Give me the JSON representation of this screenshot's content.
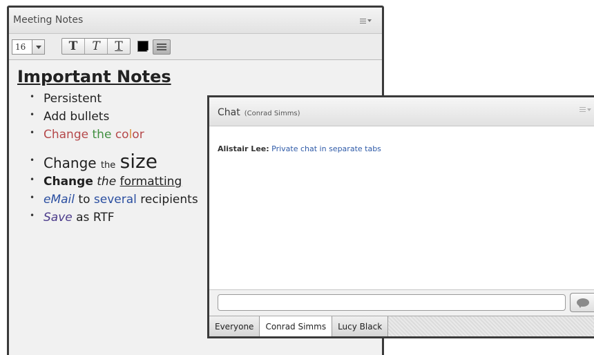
{
  "notes": {
    "title": "Meeting Notes",
    "toolbar": {
      "font_size": "16",
      "bold_glyph": "T",
      "italic_glyph": "T",
      "underline_glyph": "T",
      "text_color": "#000000"
    },
    "heading": "Important Notes",
    "items": {
      "persistent": "Persistent",
      "add_bullets": "Add bullets",
      "change_color": {
        "word1": "Change",
        "word2": "the",
        "word3_a": "co",
        "word3_b": "l",
        "word3_c": "or"
      },
      "change_size": {
        "word1": "Change",
        "word2": "the",
        "word3": "size"
      },
      "change_formatting": {
        "word1": "Change",
        "word2": "the",
        "word3": "formatting"
      },
      "email": {
        "word1": "eMail",
        "word2": "to",
        "word3": "several",
        "word4": "recipients"
      },
      "save": {
        "word1": "Save",
        "word2": "as RTF"
      }
    }
  },
  "chat": {
    "title": "Chat",
    "subtitle": "(Conrad Simms)",
    "message": {
      "sender": "Alistair Lee:",
      "text": "Private chat in separate tabs"
    },
    "input_value": "",
    "tabs": [
      "Everyone",
      "Conrad Simms",
      "Lucy Black"
    ],
    "active_tab": "Conrad Simms"
  },
  "colors": {
    "red": "#b5484a",
    "green": "#3f8f3f",
    "orange": "#d98c3a",
    "blue": "#2a4ea0",
    "purple": "#4a3a8a",
    "chat_text": "#2f5ba8"
  }
}
